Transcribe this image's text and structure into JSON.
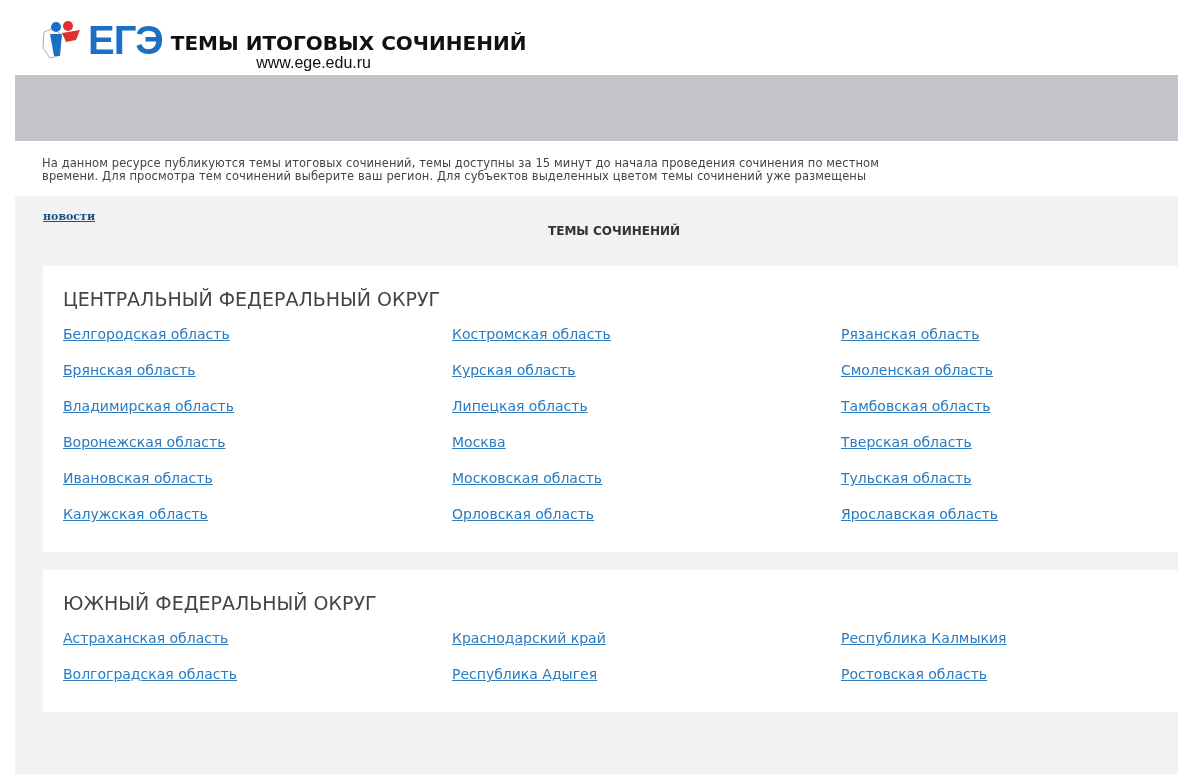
{
  "header": {
    "logo_text": "ЕГЭ",
    "title": "ТЕМЫ ИТОГОВЫХ СОЧИНЕНИЙ",
    "url": "www.ege.edu.ru"
  },
  "intro": "На данном ресурсе публикуются темы итоговых сочинений, темы доступны за 15 минут до начала проведения сочинения по местном\nвремени. Для просмотра тем сочинений выберите ваш регион. Для субъектов выделенных цветом темы сочинений уже размещены",
  "news_link": "новости",
  "section_title": "ТЕМЫ СОЧИНЕНИЙ",
  "districts": [
    {
      "title": "ЦЕНТРАЛЬНЫЙ ФЕДЕРАЛЬНЫЙ ОКРУГ",
      "columns": [
        [
          "Белгородская область",
          "Брянская область",
          "Владимирская область",
          "Воронежская область",
          "Ивановская область",
          "Калужская область"
        ],
        [
          "Костромская область",
          "Курская область",
          "Липецкая область",
          "Москва",
          "Московская область",
          "Орловская область"
        ],
        [
          "Рязанская область",
          "Смоленская область",
          "Тамбовская область",
          "Тверская область",
          "Тульская область",
          "Ярославская область"
        ]
      ]
    },
    {
      "title": "ЮЖНЫЙ ФЕДЕРАЛЬНЫЙ ОКРУГ",
      "columns": [
        [
          "Астраханская область",
          "Волгоградская область"
        ],
        [
          "Краснодарский край",
          "Республика Адыгея"
        ],
        [
          "Республика Калмыкия",
          "Ростовская область"
        ]
      ]
    }
  ]
}
